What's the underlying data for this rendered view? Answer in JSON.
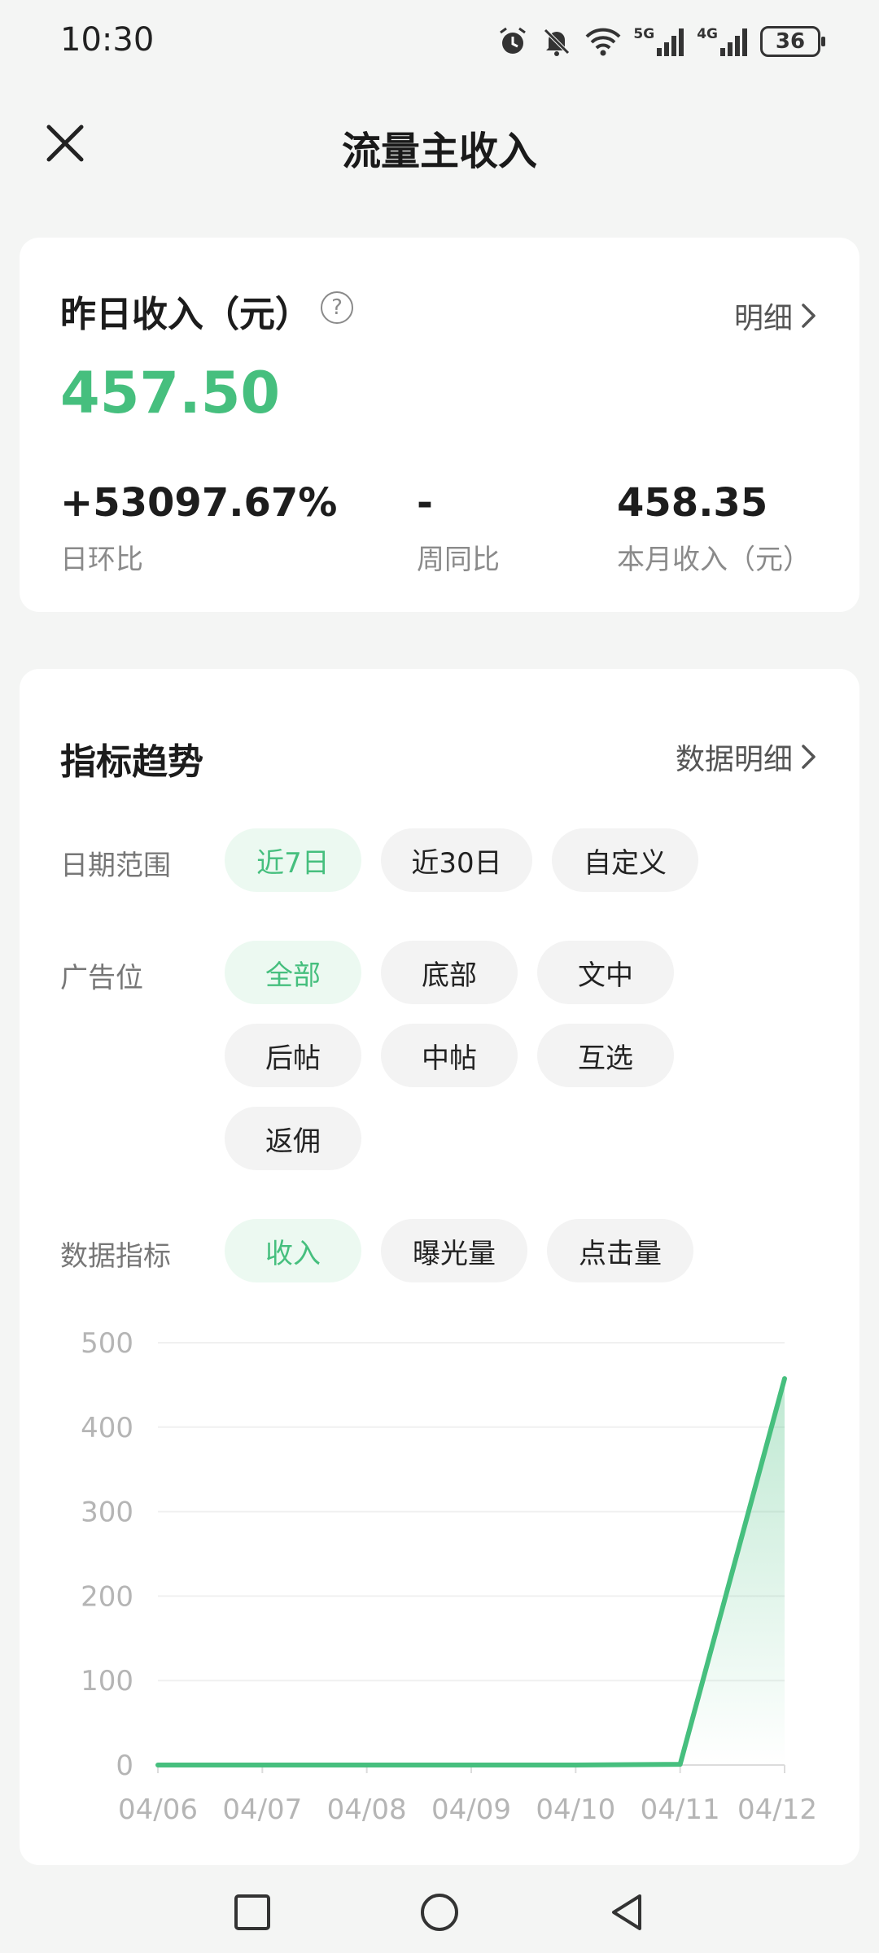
{
  "status_bar": {
    "time": "10:30",
    "battery": "36",
    "signal_1": "5G",
    "signal_2": "4G",
    "icons": [
      "alarm-icon",
      "mute-icon",
      "wifi-icon",
      "signal-5g-icon",
      "signal-4g-icon",
      "battery-icon"
    ]
  },
  "header": {
    "title": "流量主收入",
    "close_icon": "close-icon"
  },
  "summary": {
    "title": "昨日收入（元）",
    "help": "?",
    "detail_link": "明细",
    "amount": "457.50",
    "stats": [
      {
        "value": "+53097.67%",
        "label": "日环比"
      },
      {
        "value": "-",
        "label": "周同比"
      },
      {
        "value": "458.35",
        "label": "本月收入（元）"
      }
    ]
  },
  "trend": {
    "title": "指标趋势",
    "detail_link": "数据明细",
    "date_range": {
      "label": "日期范围",
      "options": [
        "近7日",
        "近30日",
        "自定义"
      ],
      "selected": "近7日"
    },
    "ad_position": {
      "label": "广告位",
      "options": [
        "全部",
        "底部",
        "文中",
        "后帖",
        "中帖",
        "互选",
        "返佣"
      ],
      "selected": "全部"
    },
    "metric": {
      "label": "数据指标",
      "options": [
        "收入",
        "曝光量",
        "点击量"
      ],
      "selected": "收入"
    }
  },
  "chart_data": {
    "type": "area",
    "x": [
      "04/06",
      "04/07",
      "04/08",
      "04/09",
      "04/10",
      "04/11",
      "04/12"
    ],
    "values": [
      0,
      0,
      0,
      0,
      0,
      0.86,
      457.5
    ],
    "ylim": [
      0,
      500
    ],
    "yticks": [
      0,
      100,
      200,
      300,
      400,
      500
    ],
    "grid": true,
    "line_color": "#46bf7e"
  },
  "colors": {
    "accent": "#46bf7e",
    "chip_active_bg": "#ecf9f1",
    "chip_bg": "#f3f3f3"
  },
  "nav_bar": {
    "icons": [
      "square-icon",
      "circle-icon",
      "back-triangle-icon"
    ]
  }
}
